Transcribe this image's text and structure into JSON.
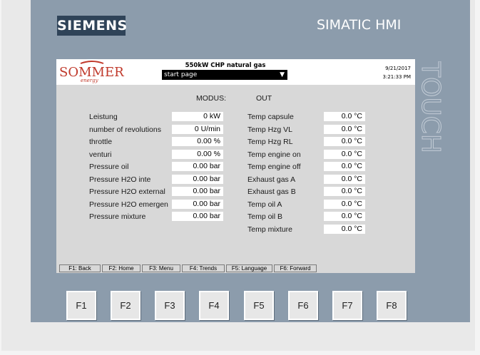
{
  "device": {
    "brand": "SIEMENS",
    "model": "SIMATIC HMI",
    "side_label": "TOUCH"
  },
  "header": {
    "logo_text": "SOMMER",
    "logo_sub": "energy",
    "title": "550kW CHP natural gas",
    "page_select": "start page",
    "date": "9/21/2017",
    "time": "3:21:33 PM"
  },
  "mode": {
    "label": "MODUS:",
    "value": "OUT"
  },
  "left_params": [
    {
      "label": "Leistung",
      "value": "0 kW"
    },
    {
      "label": "number of revolutions",
      "value": "0 U/min"
    },
    {
      "label": "throttle",
      "value": "0.00 %"
    },
    {
      "label": "venturi",
      "value": "0.00 %"
    },
    {
      "label": "Pressure oil",
      "value": "0.00 bar"
    },
    {
      "label": "Pressure H2O inte",
      "value": "0.00 bar"
    },
    {
      "label": "Pressure H2O external",
      "value": "0.00 bar"
    },
    {
      "label": "Pressure H2O emergen",
      "value": "0.00 bar"
    },
    {
      "label": "Pressure mixture",
      "value": "0.00 bar"
    }
  ],
  "right_params": [
    {
      "label": "Temp capsule",
      "value": "0.0 °C"
    },
    {
      "label": "Temp Hzg VL",
      "value": "0.0 °C"
    },
    {
      "label": "Temp Hzg RL",
      "value": "0.0 °C"
    },
    {
      "label": "Temp engine on",
      "value": "0.0 °C"
    },
    {
      "label": "Temp engine off",
      "value": "0.0 °C"
    },
    {
      "label": "Exhaust gas A",
      "value": "0.0 °C"
    },
    {
      "label": "Exhaust gas B",
      "value": "0.0 °C"
    },
    {
      "label": "Temp oil A",
      "value": "0.0 °C"
    },
    {
      "label": "Temp oil B",
      "value": "0.0 °C"
    },
    {
      "label": "Temp mixture",
      "value": "0.0 °C"
    }
  ],
  "function_bar": [
    "F1: Back",
    "F2: Home",
    "F3: Menu",
    "F4: Trends",
    "F5: Language",
    "F6: Forward"
  ],
  "keys": [
    "F1",
    "F2",
    "F3",
    "F4",
    "F5",
    "F6",
    "F7",
    "F8"
  ],
  "colors": {
    "panel": "#8c9cac",
    "logo_bg": "#2f4358",
    "screen_bg": "#d8d8d8",
    "sommer_red": "#c0392b"
  }
}
